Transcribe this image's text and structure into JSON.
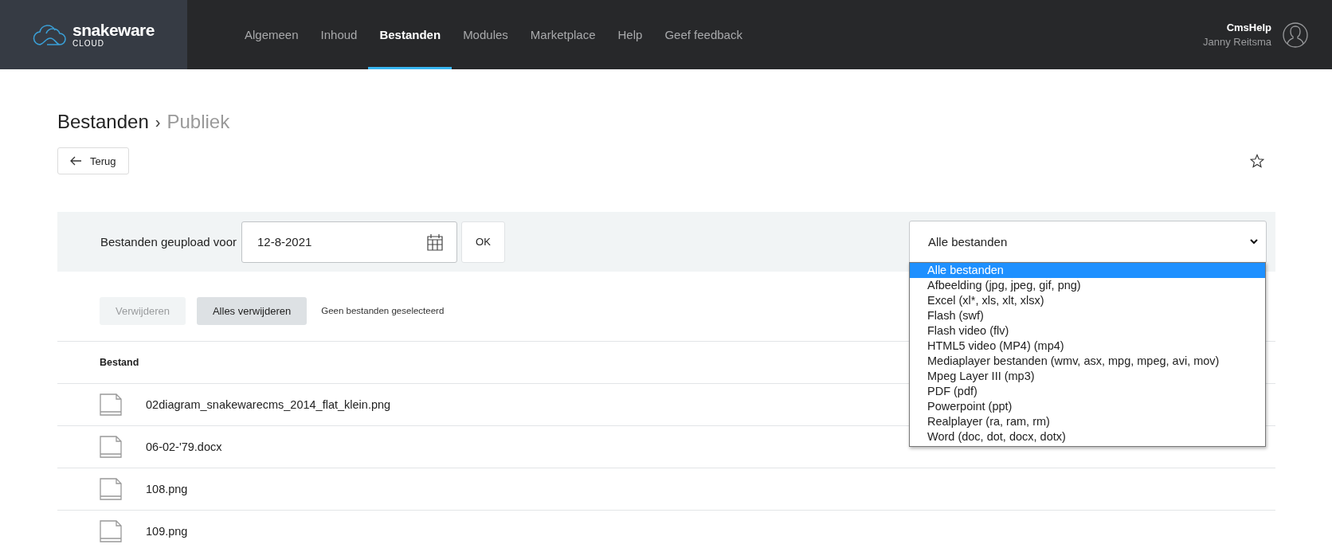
{
  "header": {
    "logo": {
      "name": "snakeware",
      "sub": "CLOUD"
    },
    "nav": [
      {
        "label": "Algemeen",
        "selected": false
      },
      {
        "label": "Inhoud",
        "selected": false
      },
      {
        "label": "Bestanden",
        "selected": true
      },
      {
        "label": "Modules",
        "selected": false
      },
      {
        "label": "Marketplace",
        "selected": false
      },
      {
        "label": "Help",
        "selected": false
      },
      {
        "label": "Geef feedback",
        "selected": false
      }
    ],
    "user": {
      "site": "CmsHelp",
      "name": "Janny Reitsma"
    }
  },
  "breadcrumb": [
    {
      "label": "Bestanden",
      "current": false
    },
    {
      "label": "Publiek",
      "current": true
    }
  ],
  "breadcrumb_separator": "›",
  "back_button": "Terug",
  "filter": {
    "label": "Bestanden geupload voor",
    "date": "12-8-2021",
    "ok": "OK",
    "type_select": {
      "value": "Alle bestanden",
      "expanded": true,
      "options": [
        {
          "label": "Alle bestanden",
          "selected": true
        },
        {
          "label": "Afbeelding (jpg, jpeg, gif, png)",
          "selected": false
        },
        {
          "label": "Excel (xl*, xls, xlt, xlsx)",
          "selected": false
        },
        {
          "label": "Flash (swf)",
          "selected": false
        },
        {
          "label": "Flash video (flv)",
          "selected": false
        },
        {
          "label": "HTML5 video (MP4) (mp4)",
          "selected": false
        },
        {
          "label": "Mediaplayer bestanden (wmv, asx, mpg, mpeg, avi, mov)",
          "selected": false
        },
        {
          "label": "Mpeg Layer III (mp3)",
          "selected": false
        },
        {
          "label": "PDF (pdf)",
          "selected": false
        },
        {
          "label": "Powerpoint (ppt)",
          "selected": false
        },
        {
          "label": "Realplayer (ra, ram, rm)",
          "selected": false
        },
        {
          "label": "Word (doc, dot, docx, dotx)",
          "selected": false
        }
      ]
    }
  },
  "actions": [
    {
      "label": "Verwijderen",
      "disabled": true
    },
    {
      "label": "Alles verwijderen",
      "disabled": false
    }
  ],
  "selection_status": "Geen bestanden geselecteerd",
  "table": {
    "columns": [
      "Bestand"
    ],
    "rows": [
      {
        "name": "02diagram_snakewarecms_2014_flat_klein.png"
      },
      {
        "name": "06-02-'79.docx"
      },
      {
        "name": "108.png"
      },
      {
        "name": "109.png"
      }
    ]
  }
}
